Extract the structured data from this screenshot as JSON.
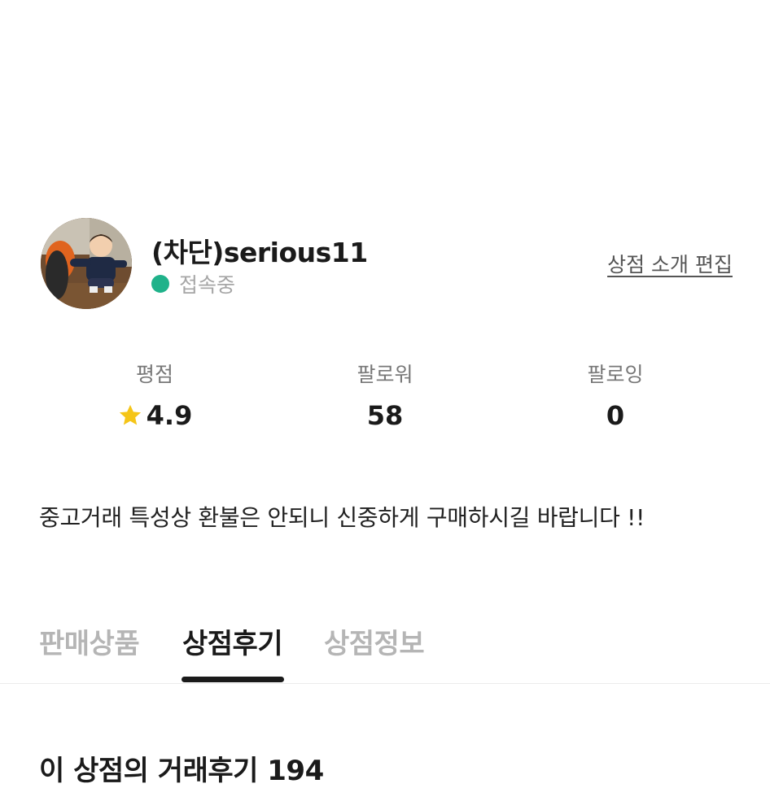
{
  "profile": {
    "shop_name": "(차단)serious11",
    "status_text": "접속중",
    "status_color": "#1fb28a",
    "edit_link": "상점 소개 편집",
    "avatar_icon": "profile-photo"
  },
  "stats": [
    {
      "label": "평점",
      "value": "4.9",
      "icon": "star-icon"
    },
    {
      "label": "팔로워",
      "value": "58"
    },
    {
      "label": "팔로잉",
      "value": "0"
    }
  ],
  "intro": "중고거래 특성상 환불은 안되니 신중하게 구매하시길 바랍니다 !!",
  "tabs": [
    {
      "label": "판매상품",
      "active": false
    },
    {
      "label": "상점후기",
      "active": true
    },
    {
      "label": "상점정보",
      "active": false
    }
  ],
  "reviews": {
    "heading": "이 상점의 거래후기 194"
  },
  "colors": {
    "star": "#f5c518",
    "active_tab": "#1a1a1a",
    "inactive_tab": "#b5b5b5"
  }
}
